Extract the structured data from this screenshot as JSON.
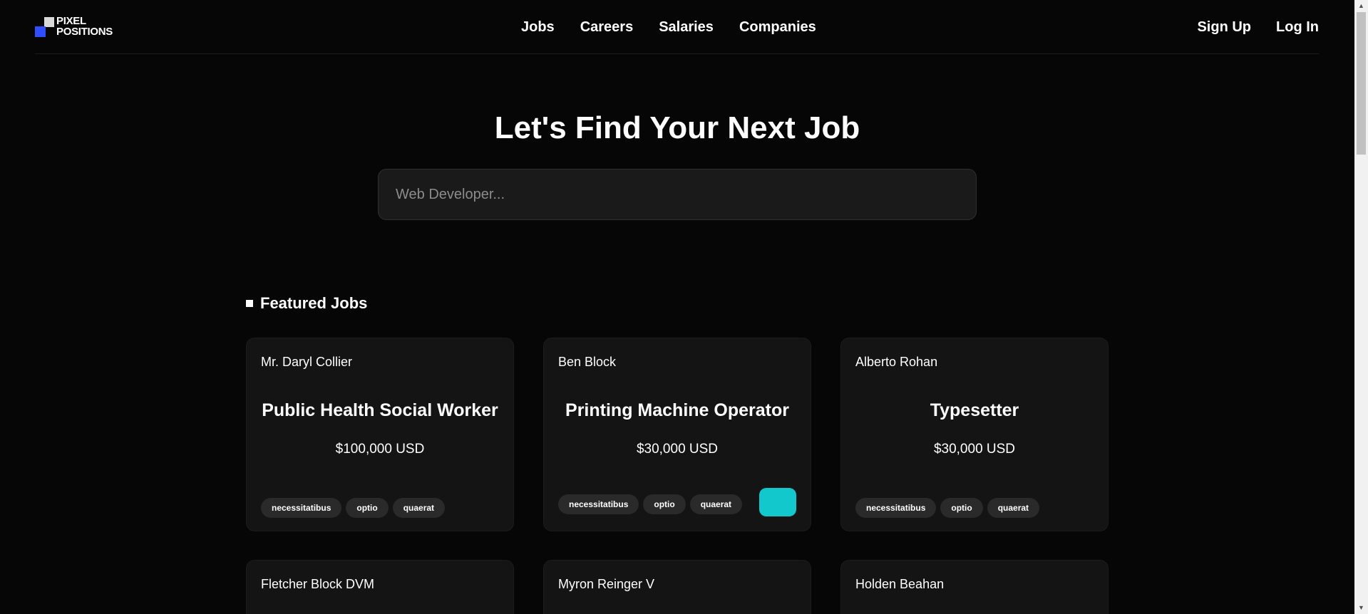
{
  "brand": {
    "line1": "PIXEL",
    "line2": "POSITIONS",
    "colors": {
      "blue": "#2f4fff",
      "gray": "#d9d9d9"
    }
  },
  "nav": {
    "items": [
      "Jobs",
      "Careers",
      "Salaries",
      "Companies"
    ]
  },
  "auth": {
    "signup": "Sign Up",
    "login": "Log In"
  },
  "hero": {
    "title": "Let's Find Your Next Job",
    "search_placeholder": "Web Developer..."
  },
  "featured": {
    "heading": "Featured Jobs",
    "jobs": [
      {
        "employer": "Mr. Daryl Collier",
        "title": "Public Health Social Worker",
        "salary": "$100,000 USD",
        "tags": [
          "necessitatibus",
          "optio",
          "quaerat"
        ]
      },
      {
        "employer": "Ben Block",
        "title": "Printing Machine Operator",
        "salary": "$30,000 USD",
        "tags": [
          "necessitatibus",
          "optio",
          "quaerat"
        ],
        "logo_color": "#12c8cc"
      },
      {
        "employer": "Alberto Rohan",
        "title": "Typesetter",
        "salary": "$30,000 USD",
        "tags": [
          "necessitatibus",
          "optio",
          "quaerat"
        ]
      },
      {
        "employer": "Fletcher Block DVM"
      },
      {
        "employer": "Myron Reinger V"
      },
      {
        "employer": "Holden Beahan"
      }
    ]
  }
}
